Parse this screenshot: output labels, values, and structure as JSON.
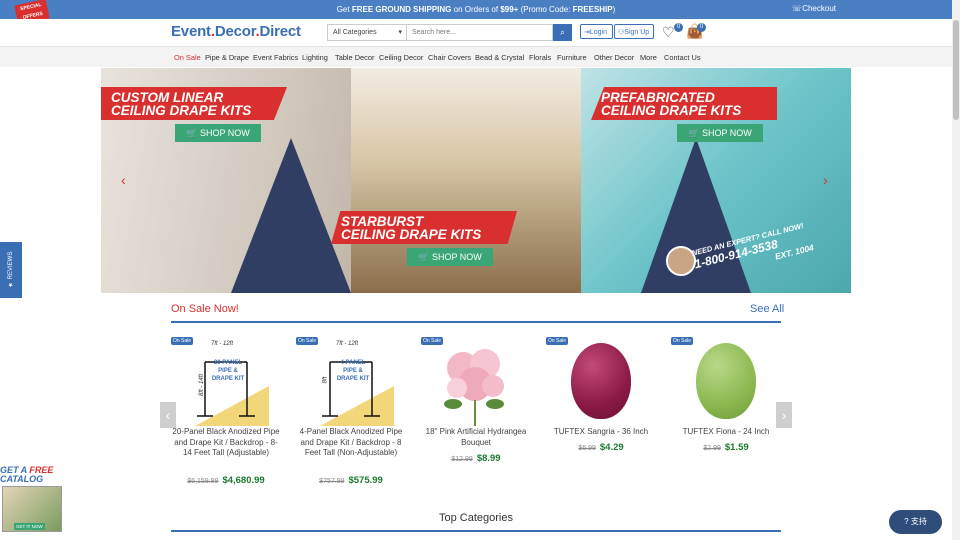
{
  "topbar": {
    "shipping_pre": "Get ",
    "shipping_bold": "FREE GROUND SHIPPING",
    "shipping_mid": " on Orders of ",
    "shipping_amount": "$99+",
    "shipping_post": " (Promo Code: ",
    "shipping_code": "FREESHIP",
    "shipping_close": ")",
    "checkout": "Checkout",
    "special_offers": "SPECIAL OFFERS"
  },
  "header": {
    "logo_part1": "Event",
    "logo_part2": "Decor",
    "logo_part3": "Direct",
    "category_select": "All Categories",
    "search_placeholder": "Search here...",
    "login": "Login",
    "signup": "Sign Up",
    "wishlist_count": "0",
    "cart_count": "0"
  },
  "nav": {
    "items": [
      "On Sale",
      "Pipe & Drape",
      "Event Fabrics",
      "Lighting",
      "Table Decor",
      "Ceiling Decor",
      "Chair Covers",
      "Bead & Crystal",
      "Florals",
      "Furniture",
      "Other Decor",
      "More",
      "Contact Us"
    ]
  },
  "hero": {
    "banner1_line1": "CUSTOM LINEAR",
    "banner1_line2": "CEILING DRAPE KITS",
    "banner2_line1": "STARBURST",
    "banner2_line2": "CEILING DRAPE KITS",
    "banner3_line1": "PREFABRICATED",
    "banner3_line2": "CEILING DRAPE KITS",
    "shop_now": "SHOP NOW",
    "expert_line1": "NEED AN EXPERT? CALL NOW!",
    "expert_phone": "1-800-914-3538",
    "expert_ext": "EXT. 1004"
  },
  "sale_section": {
    "title": "On Sale Now!",
    "see_all": "See All",
    "badge": "On Sale",
    "products": [
      {
        "name": "20-Panel Black Anodized Pipe and Drape Kit / Backdrop - 8-14 Feet Tall (Adjustable)",
        "old_price": "$6,159.99",
        "price": "$4,680.99",
        "img_label": "20 PANEL PIPE & DRAPE KIT",
        "dim_top": "7ft - 12ft",
        "dim_side": "8ft - 14ft"
      },
      {
        "name": "4-Panel Black Anodized Pipe and Drape Kit / Backdrop - 8 Feet Tall (Non-Adjustable)",
        "old_price": "$757.99",
        "price": "$575.99",
        "img_label": "4 PANEL PIPE & DRAPE KIT",
        "dim_top": "7ft - 12ft",
        "dim_side": "8ft"
      },
      {
        "name": "18\" Pink Artificial Hydrangea Bouquet",
        "old_price": "$12.99",
        "price": "$8.99"
      },
      {
        "name": "TUFTEX Sangria - 36 Inch",
        "old_price": "$6.99",
        "price": "$4.29"
      },
      {
        "name": "TUFTEX Fiona - 24 Inch",
        "old_price": "$2.99",
        "price": "$1.59"
      }
    ]
  },
  "top_categories": "Top Categories",
  "reviews": "★ REVIEWS",
  "catalog": {
    "line1a": "GET A ",
    "line1b": "FREE",
    "line2": "CATALOG",
    "cta": "GET IT NOW"
  },
  "help": "支持",
  "colors": {
    "brand_blue": "#3a6fb5",
    "accent_red": "#d9302f",
    "price_green": "#1c7a30",
    "shop_green": "#3aa675"
  }
}
